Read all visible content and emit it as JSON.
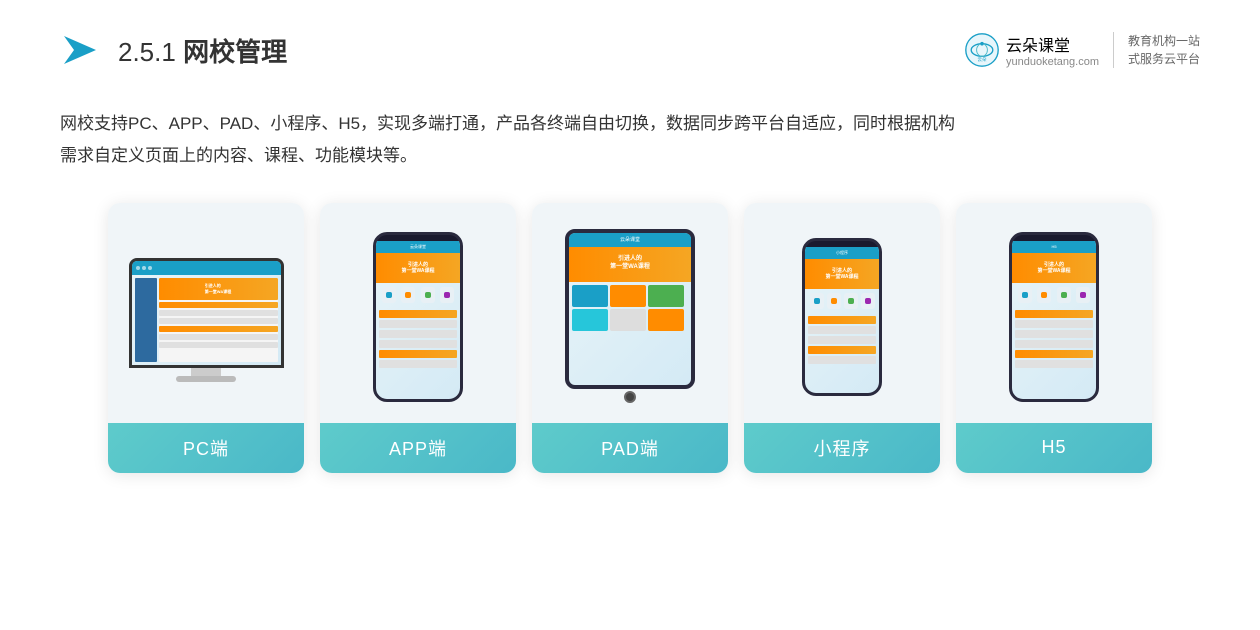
{
  "header": {
    "section": "2.5.1",
    "title": "网校管理",
    "brand": {
      "name": "云朵课堂",
      "site": "yunduoketang.com",
      "slogan_line1": "教育机构一站",
      "slogan_line2": "式服务云平台"
    }
  },
  "description": {
    "text1": "网校支持PC、APP、PAD、小程序、H5，实现多端打通，产品各终端自由切换，数据同步跨平台自适应，同时根据机构",
    "text2": "需求自定义页面上的内容、课程、功能模块等。"
  },
  "cards": [
    {
      "id": "pc",
      "label": "PC端"
    },
    {
      "id": "app",
      "label": "APP端"
    },
    {
      "id": "pad",
      "label": "PAD端"
    },
    {
      "id": "miniprogram",
      "label": "小程序"
    },
    {
      "id": "h5",
      "label": "H5"
    }
  ]
}
